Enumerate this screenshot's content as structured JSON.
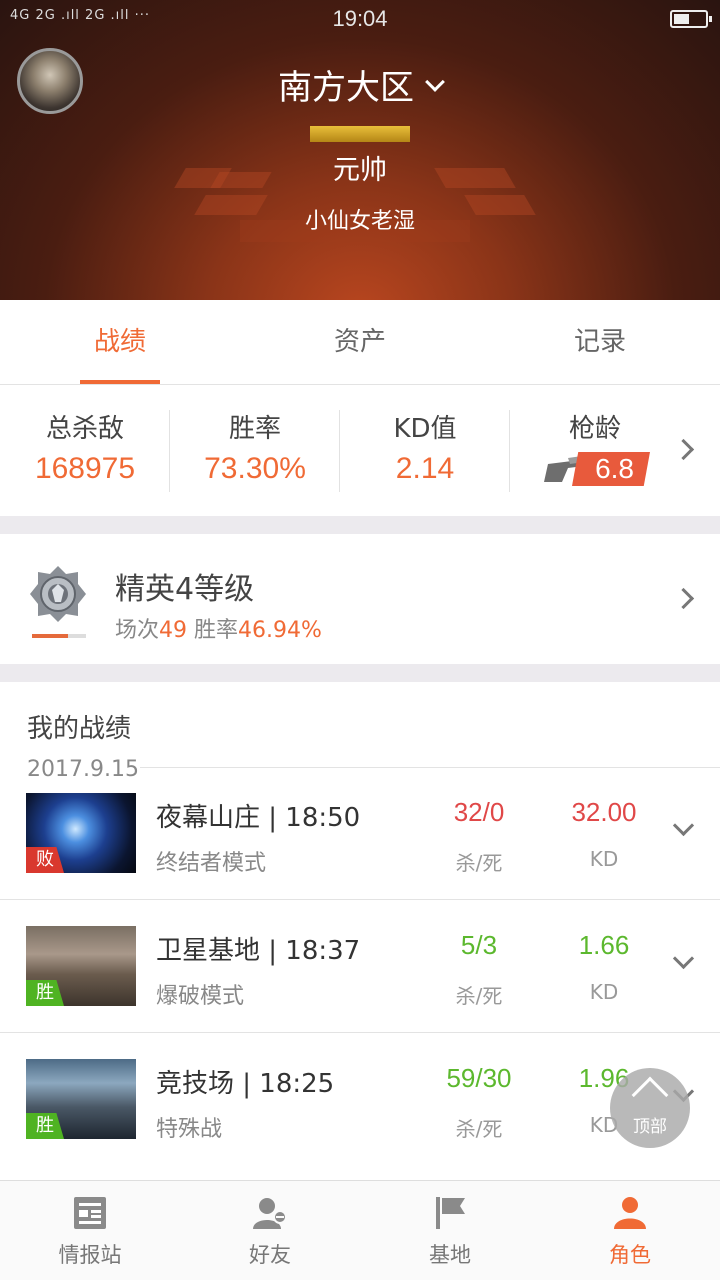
{
  "status_bar": {
    "network_left": "4G 2G .ıll 2G .ıll ··· ",
    "time": "19:04"
  },
  "header": {
    "region": "南方大区",
    "rank_title": "元帅",
    "player_name": "小仙女老湿"
  },
  "tabs": [
    {
      "label": "战绩",
      "active": true
    },
    {
      "label": "资产",
      "active": false
    },
    {
      "label": "记录",
      "active": false
    }
  ],
  "stats": {
    "total_kills": {
      "label": "总杀敌",
      "value": "168975"
    },
    "win_rate": {
      "label": "胜率",
      "value": "73.30%"
    },
    "kd": {
      "label": "KD值",
      "value": "2.14"
    },
    "gun_age": {
      "label": "枪龄",
      "value": "6.8"
    }
  },
  "rank_card": {
    "level": "精英4等级",
    "matches_label": "场次",
    "matches": "49",
    "winrate_label": " 胜率",
    "winrate": "46.94%",
    "progress": 0.66
  },
  "records": {
    "title": "我的战绩",
    "date": "2017.9.15",
    "kill_death_label": "杀/死",
    "kd_label": "KD",
    "matches": [
      {
        "name": "夜幕山庄 | 18:50",
        "mode": "终结者模式",
        "kill_death": "32/0",
        "kd": "32.00",
        "result": "败",
        "outcome": "loss"
      },
      {
        "name": "卫星基地 | 18:37",
        "mode": "爆破模式",
        "kill_death": "5/3",
        "kd": "1.66",
        "result": "胜",
        "outcome": "win"
      },
      {
        "name": "竞技场 | 18:25",
        "mode": "特殊战",
        "kill_death": "59/30",
        "kd": "1.96",
        "result": "胜",
        "outcome": "win"
      }
    ]
  },
  "top_button": {
    "label": "顶部"
  },
  "bottom_nav": [
    {
      "label": "情报站",
      "icon": "news-icon",
      "active": false
    },
    {
      "label": "好友",
      "icon": "friends-icon",
      "active": false
    },
    {
      "label": "基地",
      "icon": "flag-icon",
      "active": false
    },
    {
      "label": "角色",
      "icon": "person-icon",
      "active": true
    }
  ],
  "colors": {
    "accent": "#f06a35",
    "loss": "#e04848",
    "win": "#5cb82e",
    "loss_tag": "#d9382e",
    "win_tag": "#4fb322"
  }
}
